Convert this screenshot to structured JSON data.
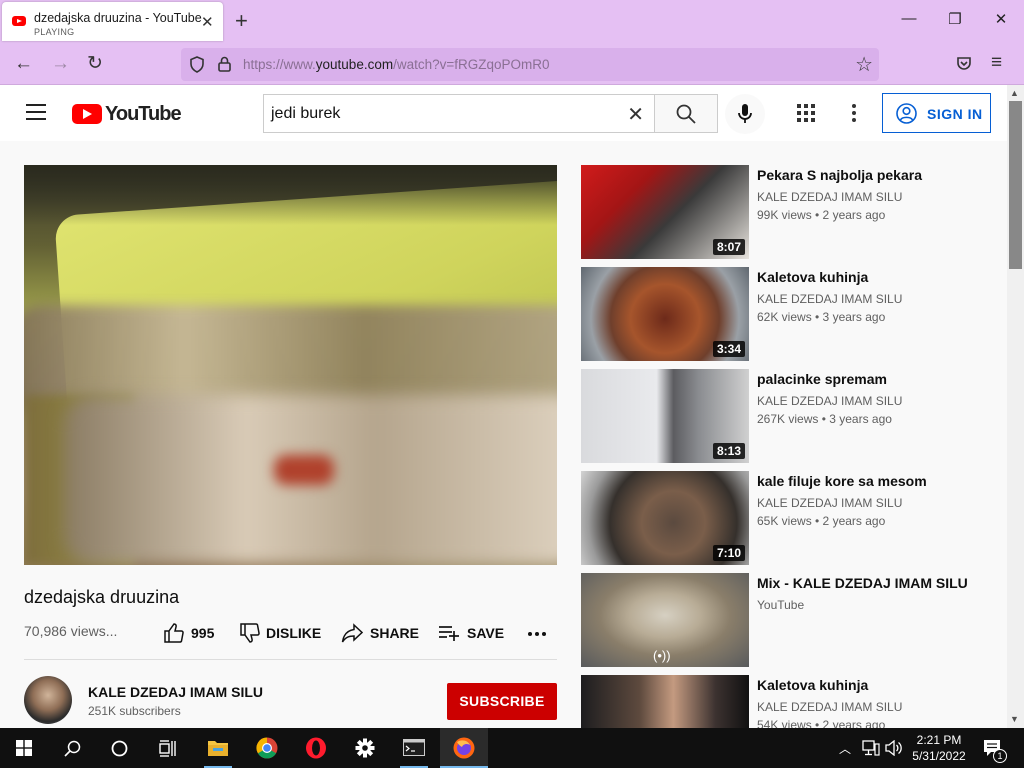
{
  "browser": {
    "tab_title": "dzedajska druuzina - YouTube",
    "tab_status": "PLAYING",
    "tab_close": "✕",
    "new_tab": "+",
    "url_prefix": "https://www.",
    "url_domain": "youtube.com",
    "url_path": "/watch?v=fRGZqoPOmR0",
    "minimize": "—",
    "maximize": "❐",
    "close": "✕",
    "back": "←",
    "forward": "→",
    "reload": "↻",
    "bookmark_star": "☆",
    "menu": "≡"
  },
  "youtube": {
    "logo_text": "YouTube",
    "search_value": "jedi burek",
    "search_clear": "✕",
    "sign_in": "SIGN IN"
  },
  "video": {
    "title": "dzedajska druuzina",
    "views": "70,986 views...",
    "likes": "995",
    "dislike": "DISLIKE",
    "share": "SHARE",
    "save": "SAVE"
  },
  "channel": {
    "name": "KALE DZEDAJ IMAM SILU",
    "subscribers": "251K subscribers",
    "subscribe": "SUBSCRIBE"
  },
  "recommendations": [
    {
      "title": "Pekara S najbolja pekara",
      "channel": "KALE DZEDAJ IMAM SILU",
      "meta": "99K views • 2 years ago",
      "duration": "8:07"
    },
    {
      "title": "Kaletova kuhinja",
      "channel": "KALE DZEDAJ IMAM SILU",
      "meta": "62K views • 3 years ago",
      "duration": "3:34"
    },
    {
      "title": "palacinke spremam",
      "channel": "KALE DZEDAJ IMAM SILU",
      "meta": "267K views • 3 years ago",
      "duration": "8:13"
    },
    {
      "title": "kale filuje kore sa mesom",
      "channel": "KALE DZEDAJ IMAM SILU",
      "meta": "65K views • 2 years ago",
      "duration": "7:10"
    },
    {
      "title": "Mix - KALE DZEDAJ IMAM SILU",
      "channel": "YouTube",
      "meta": "",
      "duration": "(•))"
    },
    {
      "title": "Kaletova kuhinja",
      "channel": "KALE DZEDAJ IMAM SILU",
      "meta": "54K views • 2 years ago",
      "duration": ""
    }
  ],
  "taskbar": {
    "time": "2:21 PM",
    "date": "5/31/2022",
    "notification_count": "1"
  },
  "colors": {
    "browser_chrome": "#e5c0f3",
    "youtube_red": "#ff0000",
    "subscribe_red": "#cc0000",
    "sign_in_blue": "#065fd4"
  }
}
